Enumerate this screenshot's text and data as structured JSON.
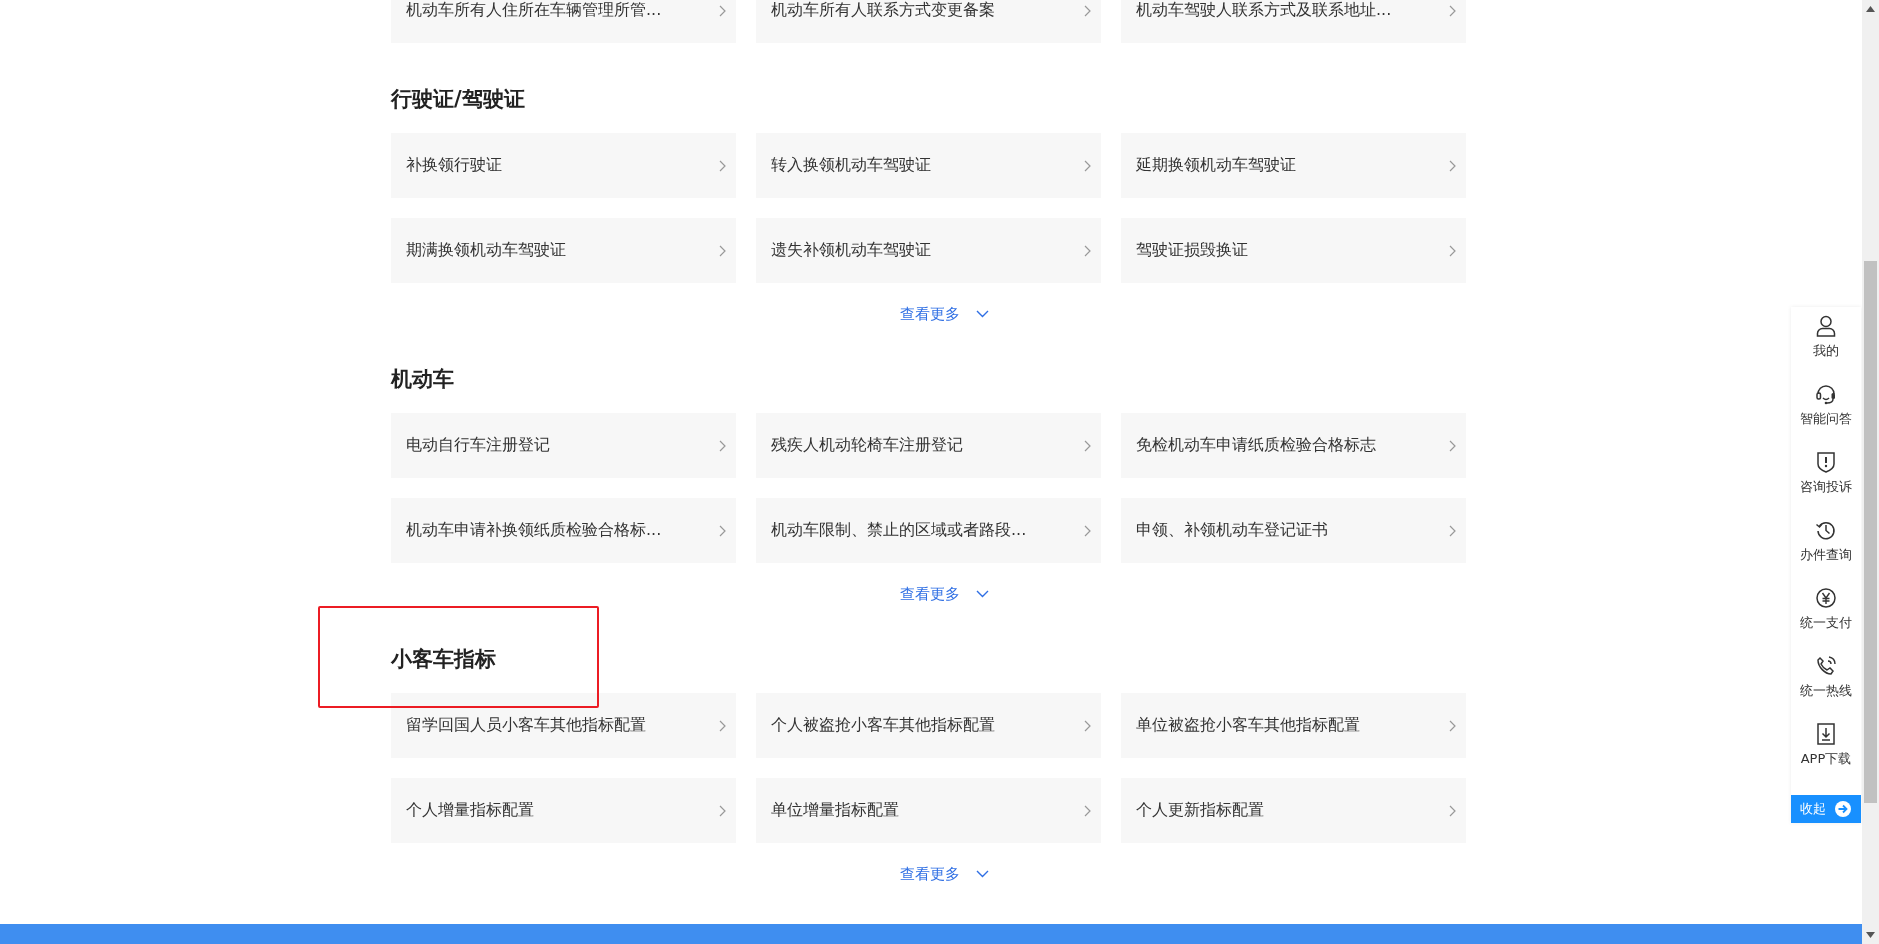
{
  "sections": [
    {
      "items": [
        "机动车所有人住所在车辆管理所管...",
        "机动车所有人联系方式变更备案",
        "机动车驾驶人联系方式及联系地址..."
      ]
    },
    {
      "title": "行驶证/驾驶证",
      "highlighted": false,
      "items": [
        "补换领行驶证",
        "转入换领机动车驾驶证",
        "延期换领机动车驾驶证",
        "期满换领机动车驾驶证",
        "遗失补领机动车驾驶证",
        "驾驶证损毁换证"
      ],
      "more": "查看更多"
    },
    {
      "title": "机动车",
      "highlighted": false,
      "items": [
        "电动自行车注册登记",
        "残疾人机动轮椅车注册登记",
        "免检机动车申请纸质检验合格标志",
        "机动车申请补换领纸质检验合格标...",
        "机动车限制、禁止的区域或者路段...",
        "申领、补领机动车登记证书"
      ],
      "more": "查看更多"
    },
    {
      "title": "小客车指标",
      "highlighted": true,
      "items": [
        "留学回国人员小客车其他指标配置",
        "个人被盗抢小客车其他指标配置",
        "单位被盗抢小客车其他指标配置",
        "个人增量指标配置",
        "单位增量指标配置",
        "个人更新指标配置"
      ],
      "more": "查看更多"
    }
  ],
  "side_menu": {
    "items": [
      "我的",
      "智能问答",
      "咨询投诉",
      "办件查询",
      "统一支付",
      "统一热线",
      "APP下载"
    ],
    "collapse": "收起"
  }
}
